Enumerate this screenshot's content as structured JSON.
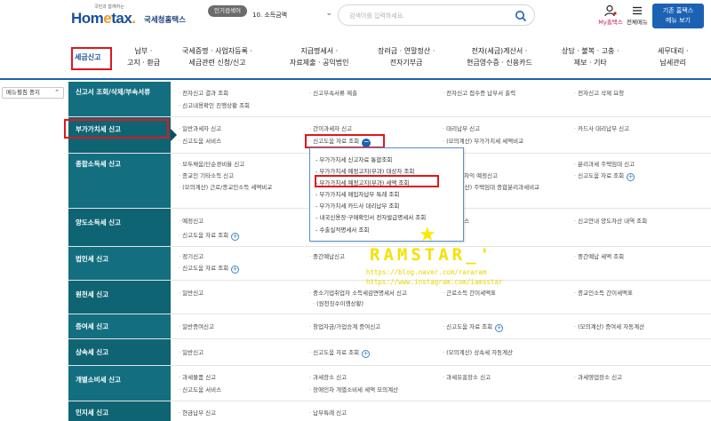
{
  "header": {
    "logo_tag": "국민과 함께하는",
    "logo_brand_a": "Hom",
    "logo_brand_b": "e",
    "logo_brand_c": "tax",
    "logo_brand_d": ".",
    "logo_sub": "국세청홈택스",
    "hot_label": "인기검색어",
    "hot_select_value": "10. 소득금액",
    "search_placeholder": "검색어를 입력하세요.",
    "my_label": "My홈택스",
    "all_menu_label": "전체메뉴",
    "old_btn_line1": "기존 홈택스",
    "old_btn_line2": "메뉴 보기"
  },
  "nav": [
    {
      "line1": "세금신고",
      "line2": ""
    },
    {
      "line1": "납부 ·",
      "line2": "고지 · 환급"
    },
    {
      "line1": "국세증명 · 사업자등록 ·",
      "line2": "세금관련 신청/신고"
    },
    {
      "line1": "지급명세서 ·",
      "line2": "자료제출 · 공익법인"
    },
    {
      "line1": "장려금 · 연말정산 ·",
      "line2": "전자기부금"
    },
    {
      "line1": "전자(세금)계산서 ·",
      "line2": "현금영수증 · 신용카드"
    },
    {
      "line1": "상담 · 불복 · 고충 ·",
      "line2": "제보 · 기타"
    },
    {
      "line1": "세무대리 ·",
      "line2": "납세관리"
    }
  ],
  "side_button": "메뉴펼침 중지",
  "rows": [
    {
      "cat": "신고서 조회/삭제/부속서류",
      "cells": [
        "전자신고 결과 조회",
        "신고부속서류 제출",
        "전자신고 접수증 납부서 출력",
        "전자신고 삭제 요청",
        "신고내용확인 진행상황 조회"
      ]
    },
    {
      "cat": "부가가치세 신고",
      "cells": [
        "일반과세자 신고",
        "간이과세자 신고",
        "대리납부 신고",
        "카드사 대리납부 신고",
        "신고도움 서비스",
        "신고도움 자료 조회",
        "(모의계산) 부가가치세 세액비교"
      ]
    },
    {
      "cat": "종합소득세 신고",
      "cells": [
        "모두채움/단순경비율 신고",
        "",
        "신고",
        "분리과세 주택임대 신고",
        "종교인 기타소득 신고",
        "",
        "부 매매차익 예정신고",
        "신고도움 자료 조회",
        "(모의계산) 근로/종교인소득 세액비교",
        "",
        "(모의계산) 주택임대 종합분리과세비교"
      ]
    },
    {
      "cat": "양도소득세 신고",
      "cells": [
        "예정신고",
        "",
        "움 서비스",
        "신고안내 양도자산 내역 조회",
        "신고도움 자료 조회"
      ]
    },
    {
      "cat": "법인세 신고",
      "cells": [
        "정기신고",
        "중간예납신고",
        "",
        "중간예납 세액 조회",
        "신고도움 자료 조회"
      ]
    },
    {
      "cat": "원천세 신고",
      "cells": [
        "일반신고",
        "중소기업취업자 소득세감면명세서 신고",
        "근로소득 간이세액표",
        "종교인소득 간이세액표",
        "(원천징수이행상황)"
      ]
    },
    {
      "cat": "증여세 신고",
      "cells": [
        "일반증여신고",
        "창업자금/가업승계 증여신고",
        "신고도움 자료 조회",
        "(모의계산) 증여세 자동계산"
      ]
    },
    {
      "cat": "상속세 신고",
      "cells": [
        "일반신고",
        "신고도움 자료 조회",
        "(모의계산) 상속세 자동계산"
      ]
    },
    {
      "cat": "개별소비세 신고",
      "cells": [
        "과세물품 신고",
        "과세장소 신고",
        "과세유흥장소 신고",
        "과세영업장소 신고",
        "신고도움 서비스",
        "장애인차 개별소비세 세액 모의계산"
      ]
    },
    {
      "cat": "인지세 신고",
      "cells": [
        "현금납부 신고",
        "납부특례 신고"
      ]
    }
  ],
  "popup": [
    "부가가치세 신고자료 통합조회",
    "부가가치세 예정고지(부과) 대상자 조회",
    "부가가치세 예정고지(부과) 세액 조회",
    "부가가치세 매입자납부 특례 조회",
    "부가가치세 카드사 대리납부 조회",
    "내국신용장·구매확인서 전자발급명세서 조회",
    "수출실적명세서 조회"
  ],
  "watermark": {
    "star": "★",
    "title": "RAMSTAR_'",
    "line1": "https://blog.naver.com/rararam",
    "line2": "https://www.instagram.com/iamsstar"
  },
  "colors": {
    "accent": "#1f5fa8",
    "category_bg": "#136f80",
    "highlight_box": "#e0161e",
    "watermark": "#f5e100"
  }
}
